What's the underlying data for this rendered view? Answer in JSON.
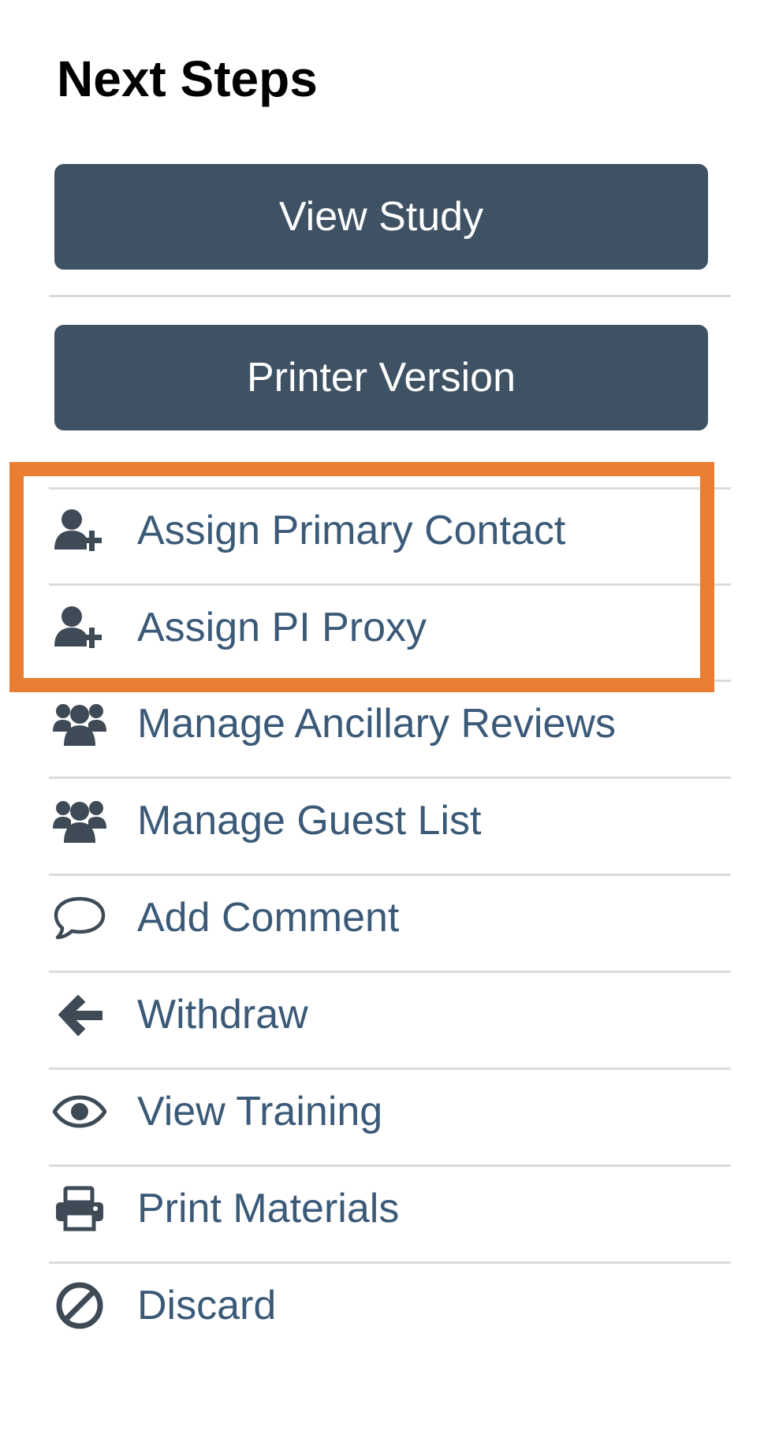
{
  "panel": {
    "title": "Next Steps",
    "buttons": {
      "view_study": "View Study",
      "printer_version": "Printer Version"
    },
    "actions": [
      {
        "label": "Assign Primary Contact",
        "icon": "user-plus-icon"
      },
      {
        "label": "Assign PI Proxy",
        "icon": "user-plus-icon"
      },
      {
        "label": "Manage Ancillary Reviews",
        "icon": "users-icon"
      },
      {
        "label": "Manage Guest List",
        "icon": "users-icon"
      },
      {
        "label": "Add Comment",
        "icon": "comment-icon"
      },
      {
        "label": "Withdraw",
        "icon": "arrow-left-icon"
      },
      {
        "label": "View Training",
        "icon": "eye-icon"
      },
      {
        "label": "Print Materials",
        "icon": "printer-icon"
      },
      {
        "label": "Discard",
        "icon": "ban-icon"
      }
    ]
  },
  "colors": {
    "button_bg": "#3e5264",
    "link": "#3b5a78",
    "icon": "#3e4a55",
    "divider": "#d9dcdf",
    "highlight": "#e97d32"
  }
}
